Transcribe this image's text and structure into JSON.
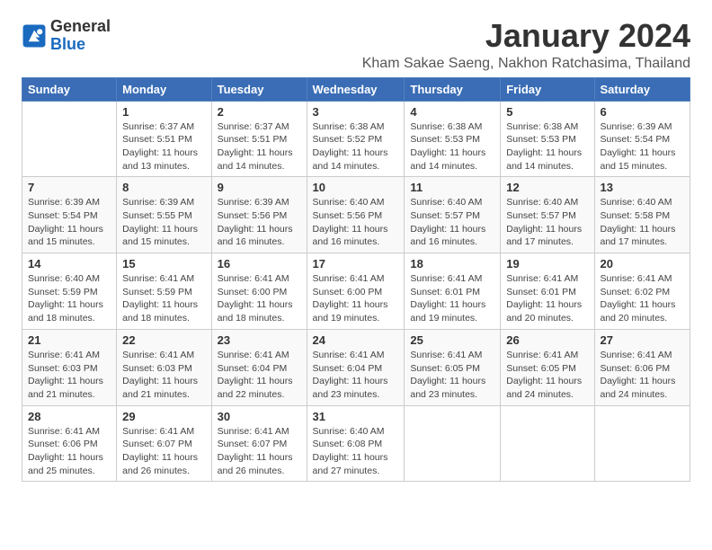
{
  "header": {
    "logo_general": "General",
    "logo_blue": "Blue",
    "month_title": "January 2024",
    "location": "Kham Sakae Saeng, Nakhon Ratchasima, Thailand"
  },
  "columns": [
    "Sunday",
    "Monday",
    "Tuesday",
    "Wednesday",
    "Thursday",
    "Friday",
    "Saturday"
  ],
  "weeks": [
    [
      {
        "day": "",
        "info": ""
      },
      {
        "day": "1",
        "info": "Sunrise: 6:37 AM\nSunset: 5:51 PM\nDaylight: 11 hours\nand 13 minutes."
      },
      {
        "day": "2",
        "info": "Sunrise: 6:37 AM\nSunset: 5:51 PM\nDaylight: 11 hours\nand 14 minutes."
      },
      {
        "day": "3",
        "info": "Sunrise: 6:38 AM\nSunset: 5:52 PM\nDaylight: 11 hours\nand 14 minutes."
      },
      {
        "day": "4",
        "info": "Sunrise: 6:38 AM\nSunset: 5:53 PM\nDaylight: 11 hours\nand 14 minutes."
      },
      {
        "day": "5",
        "info": "Sunrise: 6:38 AM\nSunset: 5:53 PM\nDaylight: 11 hours\nand 14 minutes."
      },
      {
        "day": "6",
        "info": "Sunrise: 6:39 AM\nSunset: 5:54 PM\nDaylight: 11 hours\nand 15 minutes."
      }
    ],
    [
      {
        "day": "7",
        "info": "Sunrise: 6:39 AM\nSunset: 5:54 PM\nDaylight: 11 hours\nand 15 minutes."
      },
      {
        "day": "8",
        "info": "Sunrise: 6:39 AM\nSunset: 5:55 PM\nDaylight: 11 hours\nand 15 minutes."
      },
      {
        "day": "9",
        "info": "Sunrise: 6:39 AM\nSunset: 5:56 PM\nDaylight: 11 hours\nand 16 minutes."
      },
      {
        "day": "10",
        "info": "Sunrise: 6:40 AM\nSunset: 5:56 PM\nDaylight: 11 hours\nand 16 minutes."
      },
      {
        "day": "11",
        "info": "Sunrise: 6:40 AM\nSunset: 5:57 PM\nDaylight: 11 hours\nand 16 minutes."
      },
      {
        "day": "12",
        "info": "Sunrise: 6:40 AM\nSunset: 5:57 PM\nDaylight: 11 hours\nand 17 minutes."
      },
      {
        "day": "13",
        "info": "Sunrise: 6:40 AM\nSunset: 5:58 PM\nDaylight: 11 hours\nand 17 minutes."
      }
    ],
    [
      {
        "day": "14",
        "info": "Sunrise: 6:40 AM\nSunset: 5:59 PM\nDaylight: 11 hours\nand 18 minutes."
      },
      {
        "day": "15",
        "info": "Sunrise: 6:41 AM\nSunset: 5:59 PM\nDaylight: 11 hours\nand 18 minutes."
      },
      {
        "day": "16",
        "info": "Sunrise: 6:41 AM\nSunset: 6:00 PM\nDaylight: 11 hours\nand 18 minutes."
      },
      {
        "day": "17",
        "info": "Sunrise: 6:41 AM\nSunset: 6:00 PM\nDaylight: 11 hours\nand 19 minutes."
      },
      {
        "day": "18",
        "info": "Sunrise: 6:41 AM\nSunset: 6:01 PM\nDaylight: 11 hours\nand 19 minutes."
      },
      {
        "day": "19",
        "info": "Sunrise: 6:41 AM\nSunset: 6:01 PM\nDaylight: 11 hours\nand 20 minutes."
      },
      {
        "day": "20",
        "info": "Sunrise: 6:41 AM\nSunset: 6:02 PM\nDaylight: 11 hours\nand 20 minutes."
      }
    ],
    [
      {
        "day": "21",
        "info": "Sunrise: 6:41 AM\nSunset: 6:03 PM\nDaylight: 11 hours\nand 21 minutes."
      },
      {
        "day": "22",
        "info": "Sunrise: 6:41 AM\nSunset: 6:03 PM\nDaylight: 11 hours\nand 21 minutes."
      },
      {
        "day": "23",
        "info": "Sunrise: 6:41 AM\nSunset: 6:04 PM\nDaylight: 11 hours\nand 22 minutes."
      },
      {
        "day": "24",
        "info": "Sunrise: 6:41 AM\nSunset: 6:04 PM\nDaylight: 11 hours\nand 23 minutes."
      },
      {
        "day": "25",
        "info": "Sunrise: 6:41 AM\nSunset: 6:05 PM\nDaylight: 11 hours\nand 23 minutes."
      },
      {
        "day": "26",
        "info": "Sunrise: 6:41 AM\nSunset: 6:05 PM\nDaylight: 11 hours\nand 24 minutes."
      },
      {
        "day": "27",
        "info": "Sunrise: 6:41 AM\nSunset: 6:06 PM\nDaylight: 11 hours\nand 24 minutes."
      }
    ],
    [
      {
        "day": "28",
        "info": "Sunrise: 6:41 AM\nSunset: 6:06 PM\nDaylight: 11 hours\nand 25 minutes."
      },
      {
        "day": "29",
        "info": "Sunrise: 6:41 AM\nSunset: 6:07 PM\nDaylight: 11 hours\nand 26 minutes."
      },
      {
        "day": "30",
        "info": "Sunrise: 6:41 AM\nSunset: 6:07 PM\nDaylight: 11 hours\nand 26 minutes."
      },
      {
        "day": "31",
        "info": "Sunrise: 6:40 AM\nSunset: 6:08 PM\nDaylight: 11 hours\nand 27 minutes."
      },
      {
        "day": "",
        "info": ""
      },
      {
        "day": "",
        "info": ""
      },
      {
        "day": "",
        "info": ""
      }
    ]
  ]
}
